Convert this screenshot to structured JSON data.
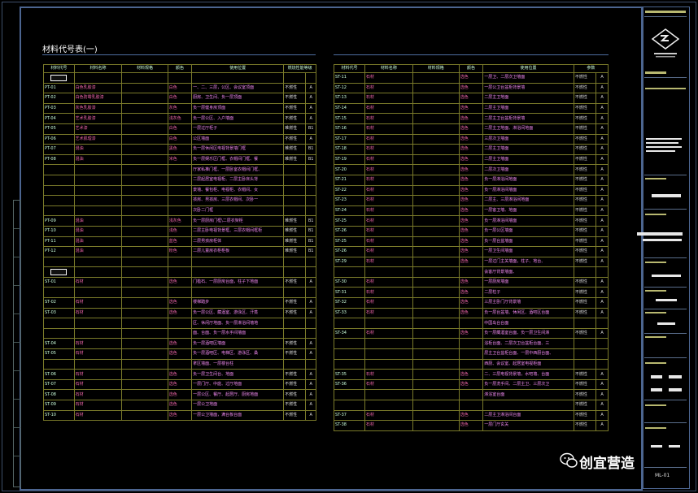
{
  "title": "材料代号表(一)",
  "left": {
    "headers": [
      "材料代号",
      "材料名称",
      "材料规格",
      "颜色",
      "使用位置",
      "燃烧性能等级"
    ],
    "rows": [
      {
        "kind": "icon"
      },
      {
        "code": "PT-01",
        "name": "白色乳胶漆",
        "color": "白色",
        "pos": "一、二、三层，公区、会议室顶面",
        "grade": "不燃性",
        "lvl": "A"
      },
      {
        "code": "PT-02",
        "name": "白色防霉乳胶漆",
        "color": "白色",
        "pos": "厨房、卫生间、负一层顶面",
        "grade": "不燃性",
        "lvl": "A"
      },
      {
        "code": "PT-03",
        "name": "灰色乳胶漆",
        "color": "灰色",
        "pos": "负一层健身房顶面",
        "grade": "不燃性",
        "lvl": "A"
      },
      {
        "code": "PT-04",
        "name": "艺术乳胶漆",
        "color": "浅灰色",
        "pos": "负一层公区、入户墙面",
        "grade": "不燃性",
        "lvl": "A"
      },
      {
        "code": "PT-05",
        "name": "艺术漆",
        "color": "白色",
        "pos": "一层过厅柜子",
        "grade": "难燃性",
        "lvl": "B1"
      },
      {
        "code": "PT-06",
        "name": "艺术肌理漆",
        "color": "白色",
        "pos": "公区墙面",
        "grade": "不燃性",
        "lvl": "A"
      },
      {
        "code": "PT-07",
        "name": "混油",
        "color": "黑色",
        "pos": "负一层休闲区电视背景墙门框",
        "grade": "难燃性",
        "lvl": "B1"
      },
      {
        "code": "PT-08",
        "name": "混油",
        "color": "米色",
        "pos": "负一层娱乐区门框、衣帽间门框、餐",
        "grade": "难燃性",
        "lvl": "B1"
      },
      {
        "code": "",
        "name": "",
        "color": "",
        "pos": "厅家私推门框、一层卧室衣帽间门框、",
        "grade": "",
        "lvl": ""
      },
      {
        "code": "",
        "name": "",
        "color": "",
        "pos": "二层起居室电视柜、二层主卧床头背",
        "grade": "",
        "lvl": ""
      },
      {
        "code": "",
        "name": "",
        "color": "",
        "pos": "景墙、餐包柜、电视柜、衣帽间、女",
        "grade": "",
        "lvl": ""
      },
      {
        "code": "",
        "name": "",
        "color": "",
        "pos": "孩房、男孩房、三层衣帽间、次卧一",
        "grade": "",
        "lvl": ""
      },
      {
        "code": "",
        "name": "",
        "color": "",
        "pos": "次卧二门框",
        "grade": "",
        "lvl": ""
      },
      {
        "code": "PT-09",
        "name": "混油",
        "color": "浅灰色",
        "pos": "负一层厨房门框\\二层衣架柜",
        "grade": "难燃性",
        "lvl": "B1"
      },
      {
        "code": "PT-10",
        "name": "混油",
        "color": "浅色",
        "pos": "二层主卧电视背景框、三层衣帽间框柜",
        "grade": "难燃性",
        "lvl": "B1"
      },
      {
        "code": "PT-11",
        "name": "混油",
        "color": "蓝色",
        "pos": "二层男孩房柜体",
        "grade": "难燃性",
        "lvl": "B1"
      },
      {
        "code": "PT-12",
        "name": "混油",
        "color": "粉色",
        "pos": "二层儿童房衣柜柜板",
        "grade": "难燃性",
        "lvl": "B1"
      },
      {
        "code": "",
        "name": "",
        "color": "",
        "pos": "",
        "grade": "",
        "lvl": ""
      },
      {
        "kind": "icon"
      },
      {
        "code": "ST-01",
        "name": "石材",
        "color": "选色",
        "pos": "门槛石、一层厨房台面，柱子下地面",
        "grade": "不燃性",
        "lvl": "A"
      },
      {
        "code": "",
        "name": "",
        "color": "",
        "pos": "",
        "grade": "",
        "lvl": ""
      },
      {
        "code": "ST-02",
        "name": "石材",
        "color": "选色",
        "pos": "楼梯踏步",
        "grade": "不燃性",
        "lvl": "A"
      },
      {
        "code": "ST-03",
        "name": "石材",
        "color": "选色",
        "pos": "负一层公区、藏酒室、游泳区、汗蒸",
        "grade": "不燃性",
        "lvl": "A"
      },
      {
        "code": "",
        "name": "",
        "color": "",
        "pos": "区、休闲厅地面、负一层淋浴间墙地",
        "grade": "",
        "lvl": ""
      },
      {
        "code": "",
        "name": "",
        "color": "",
        "pos": "面、台面、负一层水手间墙面",
        "grade": "",
        "lvl": ""
      },
      {
        "code": "ST-04",
        "name": "石材",
        "color": "选色",
        "pos": "负一层酒吧区墙面",
        "grade": "不燃性",
        "lvl": "A"
      },
      {
        "code": "ST-05",
        "name": "石材",
        "color": "选色",
        "pos": "负一层酒吧区、电梯区、游泳区、桑",
        "grade": "不燃性",
        "lvl": "A"
      },
      {
        "code": "",
        "name": "",
        "color": "",
        "pos": "拿区墙面、一层楼台柱",
        "grade": "",
        "lvl": ""
      },
      {
        "code": "ST-06",
        "name": "石材",
        "color": "选色",
        "pos": "负一层卫生间台、地面",
        "grade": "不燃性",
        "lvl": "A"
      },
      {
        "code": "ST-07",
        "name": "石材",
        "color": "选色",
        "pos": "一层门厅、中庭、过厅地面",
        "grade": "不燃性",
        "lvl": "A"
      },
      {
        "code": "ST-08",
        "name": "石材",
        "color": "选色",
        "pos": "一层公区、餐厅、起居厅、厨房地面",
        "grade": "不燃性",
        "lvl": "A"
      },
      {
        "code": "ST-09",
        "name": "石材",
        "color": "选色",
        "pos": "一层公卫地面",
        "grade": "不燃性",
        "lvl": "A"
      },
      {
        "code": "ST-10",
        "name": "石材",
        "color": "选色",
        "pos": "一层公卫墙面，满台板台面",
        "grade": "不燃性",
        "lvl": "A"
      }
    ]
  },
  "right": {
    "headers": [
      "材料代号",
      "材料名称",
      "材料规格",
      "颜色",
      "使用位置",
      "参数"
    ],
    "rows": [
      {
        "code": "ST-11",
        "name": "石材",
        "color": "选色",
        "pos": "一层卫、二层次卫墙面",
        "grade": "不燃性",
        "lvl": "A"
      },
      {
        "code": "ST-12",
        "name": "石材",
        "color": "选色",
        "pos": "一层公卫台盆柜背景墙",
        "grade": "不燃性",
        "lvl": "A"
      },
      {
        "code": "ST-13",
        "name": "石材",
        "color": "选色",
        "pos": "二层主卫地面",
        "grade": "不燃性",
        "lvl": "A"
      },
      {
        "code": "ST-14",
        "name": "石材",
        "color": "选色",
        "pos": "二层主卫墙面",
        "grade": "不燃性",
        "lvl": "A"
      },
      {
        "code": "ST-15",
        "name": "石材",
        "color": "选色",
        "pos": "二层主卫台盆柜背景墙",
        "grade": "不燃性",
        "lvl": "A"
      },
      {
        "code": "ST-16",
        "name": "石材",
        "color": "选色",
        "pos": "二层主卫地面、淋浴间地面",
        "grade": "不燃性",
        "lvl": "A"
      },
      {
        "code": "ST-17",
        "name": "石材",
        "color": "选色",
        "pos": "三层次卫墙面",
        "grade": "不燃性",
        "lvl": "A"
      },
      {
        "code": "ST-18",
        "name": "石材",
        "color": "选色",
        "pos": "二层主卫墙面",
        "grade": "不燃性",
        "lvl": "A"
      },
      {
        "code": "ST-19",
        "name": "石材",
        "color": "选色",
        "pos": "二层主卫墙面",
        "grade": "不燃性",
        "lvl": "A"
      },
      {
        "code": "ST-20",
        "name": "石材",
        "color": "选色",
        "pos": "二层次卫墙面",
        "grade": "不燃性",
        "lvl": "A"
      },
      {
        "code": "ST-21",
        "name": "石材",
        "color": "选色",
        "pos": "负一层淋浴间地面",
        "grade": "不燃性",
        "lvl": "A"
      },
      {
        "code": "ST-22",
        "name": "石材",
        "color": "选色",
        "pos": "负一层淋浴间墙面",
        "grade": "不燃性",
        "lvl": "A"
      },
      {
        "code": "ST-23",
        "name": "石材",
        "color": "选色",
        "pos": "二层主、三层淋浴间地面",
        "grade": "不燃性",
        "lvl": "A"
      },
      {
        "code": "ST-24",
        "name": "石材",
        "color": "选色",
        "pos": "一层客卫墙、地面",
        "grade": "不燃性",
        "lvl": "A"
      },
      {
        "code": "ST-25",
        "name": "石材",
        "color": "选色",
        "pos": "负一层淋浴间墙面",
        "grade": "不燃性",
        "lvl": "A"
      },
      {
        "code": "ST-26",
        "name": "石材",
        "color": "选色",
        "pos": "负一层公区墙面",
        "grade": "不燃性",
        "lvl": "A"
      },
      {
        "code": "ST-25",
        "name": "石材",
        "color": "选色",
        "pos": "负一层台盆墙面",
        "grade": "不燃性",
        "lvl": "A"
      },
      {
        "code": "ST-26",
        "name": "石材",
        "color": "选色",
        "pos": "一层卫生间墙面",
        "grade": "不燃性",
        "lvl": "A"
      },
      {
        "code": "ST-29",
        "name": "石材",
        "color": "选色",
        "pos": "一层过门主关墙面，柱子、地台、",
        "grade": "不燃性",
        "lvl": "A"
      },
      {
        "code": "",
        "name": "",
        "color": "",
        "pos": "会客厅背景墙面、",
        "grade": "",
        "lvl": ""
      },
      {
        "code": "ST-30",
        "name": "石材",
        "color": "选色",
        "pos": "一层厨房墙面",
        "grade": "不燃性",
        "lvl": "A"
      },
      {
        "code": "ST-31",
        "name": "石材",
        "color": "选色",
        "pos": "二层柱子",
        "grade": "不燃性",
        "lvl": "A"
      },
      {
        "code": "ST-32",
        "name": "石材",
        "color": "选色",
        "pos": "三层主卧门厅背景墙",
        "grade": "不燃性",
        "lvl": "A"
      },
      {
        "code": "ST-33",
        "name": "石材",
        "color": "选色",
        "pos": "负一层台盆墙、休闲区、酒吧区台面",
        "grade": "不燃性",
        "lvl": "A"
      },
      {
        "code": "",
        "name": "",
        "color": "",
        "pos": "中国岛台台面",
        "grade": "",
        "lvl": ""
      },
      {
        "code": "ST-34",
        "name": "石材",
        "color": "选色",
        "pos": "负一层藏酒室台面、负一层卫生间淋",
        "grade": "不燃性",
        "lvl": "A"
      },
      {
        "code": "",
        "name": "",
        "color": "",
        "pos": "浴柜台面、二层次卫台盆柜台面、三",
        "grade": "",
        "lvl": ""
      },
      {
        "code": "",
        "name": "",
        "color": "",
        "pos": "层主卫台盆柜台面、一层中西厨台面、",
        "grade": "",
        "lvl": ""
      },
      {
        "code": "",
        "name": "",
        "color": "",
        "pos": "西厨、会议室、起居室电视柜面",
        "grade": "",
        "lvl": ""
      },
      {
        "code": "ST-35",
        "name": "石材",
        "color": "选色",
        "pos": "二、三层电视背景墙，水吧墙、台面",
        "grade": "不燃性",
        "lvl": "A"
      },
      {
        "code": "ST-36",
        "name": "石材",
        "color": "选色",
        "pos": "负一层洗手间、二层主卫、三层次卫",
        "grade": "不燃性",
        "lvl": "A"
      },
      {
        "code": "",
        "name": "",
        "color": "",
        "pos": "淋浴室台面",
        "grade": "不燃性",
        "lvl": "A"
      },
      {
        "code": "",
        "name": "",
        "color": "",
        "pos": "",
        "grade": "不燃性",
        "lvl": "A"
      },
      {
        "code": "ST-37",
        "name": "石材",
        "color": "选色",
        "pos": "二层主卫淋浴间台面",
        "grade": "不燃性",
        "lvl": "A"
      },
      {
        "code": "ST-38",
        "name": "石材",
        "color": "选色",
        "pos": "一层门厅玄关",
        "grade": "不燃性",
        "lvl": "A"
      }
    ]
  },
  "titleblock": {
    "sheet_no": "ML-01"
  },
  "watermark": {
    "brand": "创宜营造"
  }
}
